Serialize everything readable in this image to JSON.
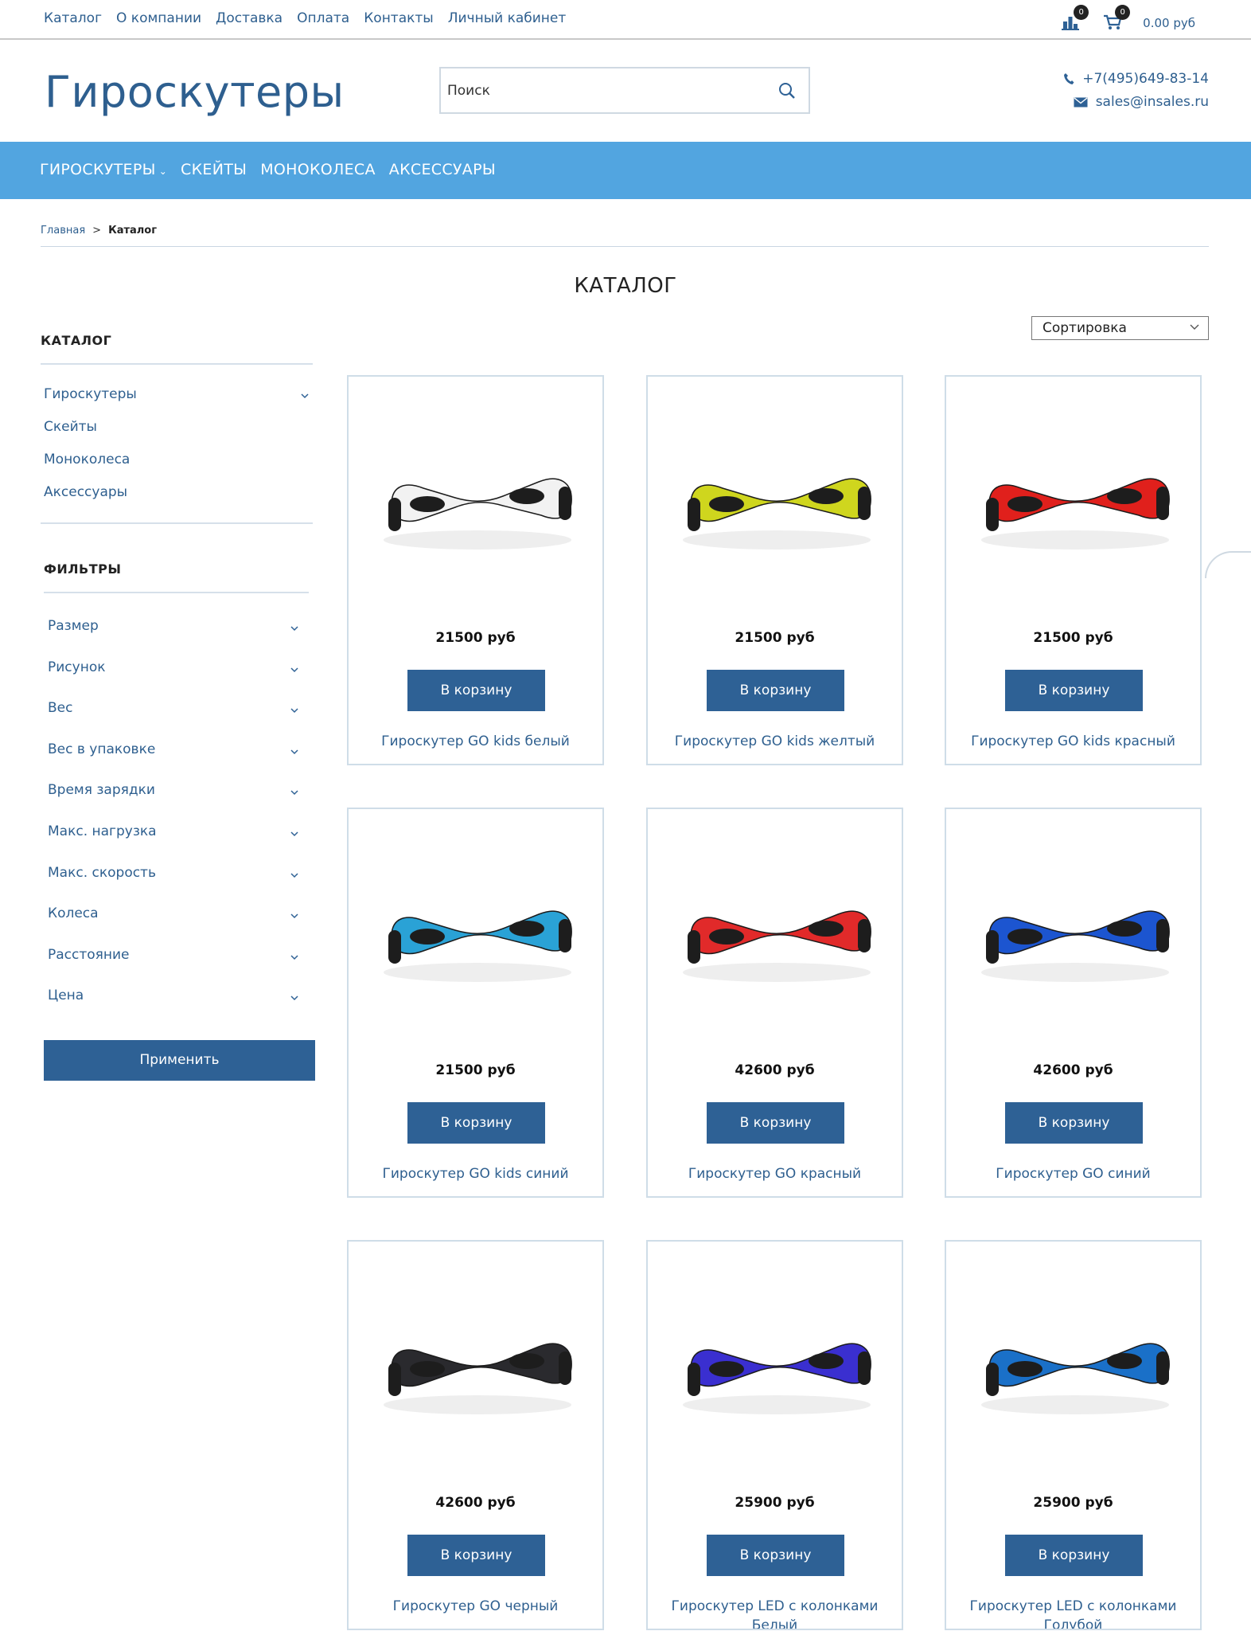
{
  "topnav": [
    "Каталог",
    "О компании",
    "Доставка",
    "Оплата",
    "Контакты",
    "Личный кабинет"
  ],
  "compare_count": "0",
  "cart_count": "0",
  "cart_total": "0.00 руб",
  "logo": "Гироскутеры",
  "search": {
    "placeholder": "Поиск"
  },
  "contacts": {
    "phone": "+7(495)649-83-14",
    "email": "sales@insales.ru"
  },
  "mainmenu": [
    "ГИРОСКУТЕРЫ",
    "СКЕЙТЫ",
    "МОНОКОЛЕСА",
    "АКСЕССУАРЫ"
  ],
  "breadcrumb": {
    "home": "Главная",
    "sep": ">",
    "current": "Каталог"
  },
  "page_title": "КАТАЛОГ",
  "sort_label": "Сортировка",
  "sidebar": {
    "catalog_title": "КАТАЛОГ",
    "categories": [
      "Гироскутеры",
      "Скейты",
      "Моноколеса",
      "Аксессуары"
    ],
    "filters_title": "ФИЛЬТРЫ",
    "filters": [
      "Размер",
      "Рисунок",
      "Вес",
      "Вес в упаковке",
      "Время зарядки",
      "Макс. нагрузка",
      "Макс. скорость",
      "Колеса",
      "Расстояние",
      "Цена"
    ],
    "apply": "Применить"
  },
  "buy_label": "В корзину",
  "products": [
    {
      "name": "Гироскутер GO kids белый",
      "price": "21500 руб",
      "color": "#f2f2f2"
    },
    {
      "name": "Гироскутер GO kids желтый",
      "price": "21500 руб",
      "color": "#cfd61e"
    },
    {
      "name": "Гироскутер GO kids красный",
      "price": "21500 руб",
      "color": "#e0201c"
    },
    {
      "name": "Гироскутер GO kids синий",
      "price": "21500 руб",
      "color": "#2aa2d6"
    },
    {
      "name": "Гироскутер GO красный",
      "price": "42600 руб",
      "color": "#e12a2a"
    },
    {
      "name": "Гироскутер GO синий",
      "price": "42600 руб",
      "color": "#1c55d0"
    },
    {
      "name": "Гироскутер GO черный",
      "price": "42600 руб",
      "color": "#2a2a2e"
    },
    {
      "name": "Гироскутер LED с колонками Белый",
      "price": "25900 руб",
      "color": "#3a2fd0"
    },
    {
      "name": "Гироскутер LED с колонками Голубой",
      "price": "25900 руб",
      "color": "#1a70c8"
    }
  ]
}
